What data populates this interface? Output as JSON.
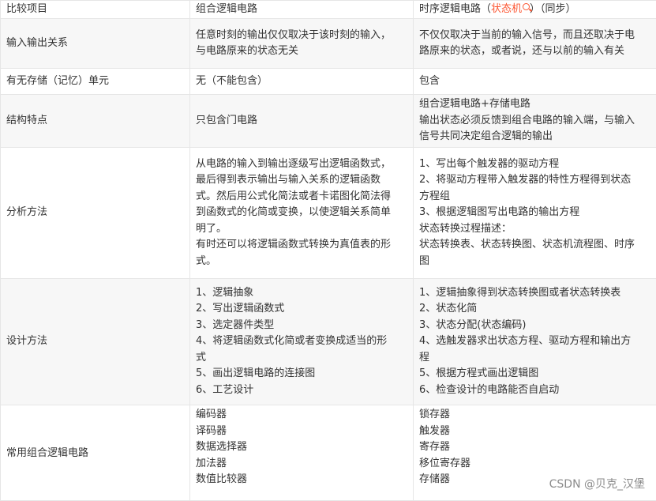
{
  "table": {
    "headers": {
      "item": "比较项目",
      "combinational": "组合逻辑电路",
      "sequential_prefix": "时序逻辑电路（",
      "sequential_link": "状态机",
      "sequential_suffix": "）（同步）"
    },
    "rows": [
      {
        "item": "输入输出关系",
        "combinational": [
          "任意时刻的输出仅仅取决于该时刻的输入，",
          "与电路原来的状态无关"
        ],
        "sequential": [
          "不仅仅取决于当前的输入信号，而且还取决于电",
          "路原来的状态，或者说，还与以前的输入有关"
        ]
      },
      {
        "item": "有无存储（记忆）单元",
        "combinational": [
          "无（不能包含）"
        ],
        "sequential": [
          "包含"
        ]
      },
      {
        "item": "结构特点",
        "combinational": [
          "只包含门电路"
        ],
        "sequential": [
          "组合逻辑电路+存储电路",
          "输出状态必须反馈到组合电路的输入端，与输入",
          "信号共同决定组合逻辑的输出"
        ]
      },
      {
        "item": "分析方法",
        "combinational": [
          "从电路的输入到输出逐级写出逻辑函数式，",
          "最后得到表示输出与输入关系的逻辑函数",
          "式。然后用公式化简法或者卡诺图化简法得",
          "到函数式的化简或变换，以使逻辑关系简单",
          "明了。",
          "有时还可以将逻辑函数式转换为真值表的形",
          "式。"
        ],
        "sequential": [
          "1、写出每个触发器的驱动方程",
          "2、将驱动方程带入触发器的特性方程得到状态",
          "方程组",
          "3、根据逻辑图写出电路的输出方程",
          "状态转换过程描述：",
          "状态转换表、状态转换图、状态机流程图、时序",
          "图"
        ]
      },
      {
        "item": "设计方法",
        "combinational": [
          "1、逻辑抽象",
          "2、写出逻辑函数式",
          "3、选定器件类型",
          "4、将逻辑函数式化简或者变换成适当的形",
          "式",
          "5、画出逻辑电路的连接图",
          "6、工艺设计"
        ],
        "sequential": [
          "1、逻辑抽象得到状态转换图或者状态转换表",
          "2、状态化简",
          "3、状态分配(状态编码)",
          "4、选触发器求出状态方程、驱动方程和输出方",
          "程",
          "5、根据方程式画出逻辑图",
          "6、检查设计的电路能否自启动"
        ]
      },
      {
        "item": "常用组合逻辑电路",
        "combinational": [
          "编码器",
          "译码器",
          "数据选择器",
          "加法器",
          "数值比较器"
        ],
        "sequential": [
          "锁存器",
          "触发器",
          "寄存器",
          "移位寄存器",
          "存储器"
        ]
      }
    ]
  },
  "watermark": "CSDN @贝克_汉堡",
  "colors": {
    "link": "#fc5531",
    "border": "#e6e6e6",
    "stripe": "#f7f7f7",
    "text": "#333333"
  },
  "icons": [
    "search-icon"
  ]
}
